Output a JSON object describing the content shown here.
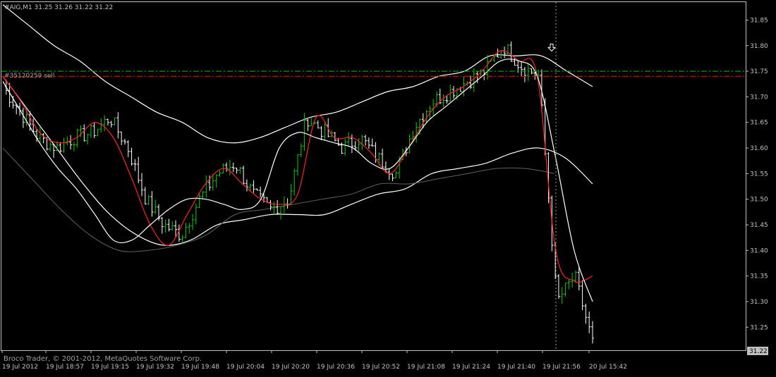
{
  "header": {
    "symbol_info": "#AIG,M1  31.25 31.26 31.22 31.22"
  },
  "order_label": "#35120259 sell",
  "footer": {
    "copyright": "Broco Trader, © 2001-2012, MetaQuotes Software Corp."
  },
  "current_price_label": "31.22",
  "colors": {
    "background": "#000000",
    "axis": "#c0c0c0",
    "bull_bar": "#00cc00",
    "bear_bar": "#ffffff",
    "fast_ma": "#ff2020",
    "slow_ma": "#ffffff",
    "envelope": "#606060",
    "order_green": "#00aa00",
    "order_red": "#dd0000"
  },
  "chart_data": {
    "type": "ohlc",
    "title": "#AIG,M1",
    "ylim": [
      31.205,
      31.885
    ],
    "y_ticks": [
      "31.85",
      "31.80",
      "31.75",
      "31.70",
      "31.65",
      "31.60",
      "31.55",
      "31.50",
      "31.45",
      "31.40",
      "31.35",
      "31.30",
      "31.25"
    ],
    "x_ticks": [
      "19 Jul 2012",
      "19 Jul 18:57",
      "19 Jul 19:15",
      "19 Jul 19:32",
      "19 Jul 19:48",
      "19 Jul 20:04",
      "19 Jul 20:20",
      "19 Jul 20:36",
      "19 Jul 20:52",
      "19 Jul 21:08",
      "19 Jul 21:24",
      "19 Jul 21:40",
      "19 Jul 21:56",
      "20 Jul 15:42"
    ],
    "horizontal_lines": [
      {
        "name": "order_green",
        "price": 31.75,
        "style": "dash-dot"
      },
      {
        "name": "order_red",
        "price": 31.74,
        "style": "dash-dot"
      }
    ],
    "close_anchors": [
      31.72,
      31.67,
      31.62,
      31.6,
      31.62,
      31.63,
      31.66,
      31.6,
      31.5,
      31.45,
      31.43,
      31.5,
      31.55,
      31.57,
      31.51,
      31.48,
      31.5,
      31.66,
      31.63,
      31.6,
      31.62,
      31.58,
      31.55,
      31.64,
      31.69,
      31.71,
      31.73,
      31.75,
      31.8,
      31.76,
      31.74,
      31.3,
      31.35,
      31.22
    ],
    "fast_ma": [
      31.74,
      31.69,
      31.63,
      31.61,
      31.62,
      31.65,
      31.62,
      31.54,
      31.45,
      31.41,
      31.47,
      31.53,
      31.56,
      31.53,
      31.5,
      31.49,
      31.51,
      31.66,
      31.62,
      31.62,
      31.59,
      31.55,
      31.6,
      31.66,
      31.7,
      31.72,
      31.75,
      31.79,
      31.77,
      31.74,
      31.4,
      31.34,
      31.35
    ],
    "slow_ma": [
      31.73,
      31.67,
      31.61,
      31.56,
      31.52,
      31.47,
      31.42,
      31.42,
      31.45,
      31.48,
      31.5,
      31.5,
      31.49,
      31.48,
      31.5,
      31.6,
      31.63,
      31.62,
      31.61,
      31.6,
      31.57,
      31.56,
      31.6,
      31.65,
      31.68,
      31.71,
      31.74,
      31.77,
      31.77,
      31.74,
      31.58,
      31.4,
      31.3
    ],
    "upper_band": [
      31.88,
      31.84,
      31.8,
      31.77,
      31.73,
      31.7,
      31.67,
      31.65,
      31.62,
      31.61,
      31.62,
      31.64,
      31.66,
      31.67,
      31.69,
      31.71,
      31.72,
      31.74,
      31.75,
      31.78,
      31.78,
      31.78,
      31.75,
      31.72
    ],
    "middle_band": [
      31.74,
      31.67,
      31.6,
      31.53,
      31.47,
      31.43,
      31.41,
      31.42,
      31.45,
      31.46,
      31.47,
      31.47,
      31.47,
      31.49,
      31.51,
      31.52,
      31.55,
      31.56,
      31.57,
      31.59,
      31.6,
      31.58,
      31.53
    ],
    "lower_band": [
      31.6,
      31.54,
      31.48,
      31.43,
      31.4,
      31.4,
      31.41,
      31.43,
      31.47,
      31.48,
      31.49,
      31.5,
      31.51,
      31.53,
      31.53,
      31.54,
      31.55,
      31.56,
      31.56,
      31.55
    ]
  }
}
